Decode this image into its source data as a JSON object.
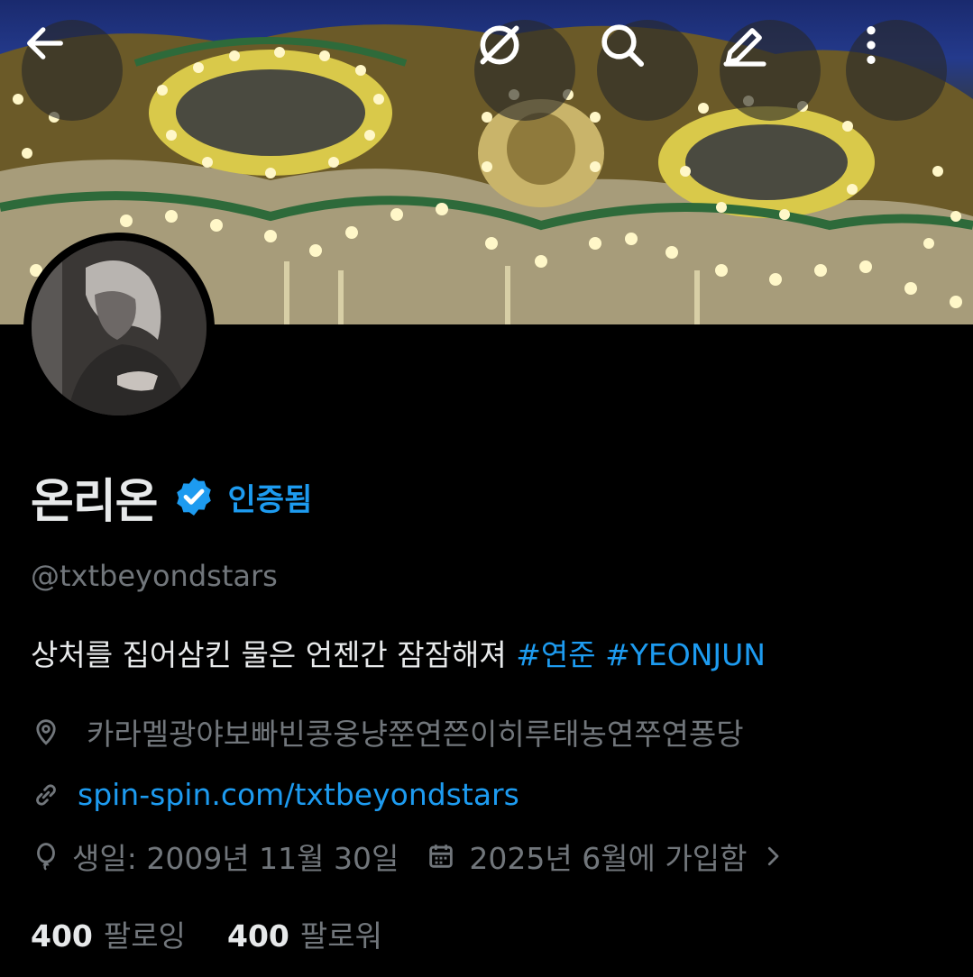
{
  "profile": {
    "display_name": "온리온",
    "verified_label": "인증됨",
    "handle": "@txtbeyondstars",
    "bio_text": "상처를 집어삼킨 물은 언젠간 잠잠해져 ",
    "hashtags": [
      "#연준",
      "#YEONJUN"
    ],
    "location": "카라멜광야보빠빈콩웅냥쭌연쯘이히루태농연쭈연퐁당",
    "website": "spin-spin.com/txtbeyondstars",
    "birthday": "생일: 2009년 11월 30일",
    "joined": "2025년 6월에 가입함",
    "following_count": "400",
    "following_label": "팔로잉",
    "followers_count": "400",
    "followers_label": "팔로워"
  },
  "icons": {
    "back": "arrow-left-icon",
    "grok": "grok-icon",
    "search": "search-icon",
    "edit": "edit-icon",
    "more": "more-vertical-icon",
    "verified": "verified-badge-icon",
    "location": "location-pin-icon",
    "link": "link-icon",
    "birthday": "balloon-icon",
    "calendar": "calendar-icon",
    "chevron": "chevron-right-icon"
  },
  "colors": {
    "accent": "#1d9bf0",
    "text_primary": "#e7e9ea",
    "text_secondary": "#71767b",
    "background": "#000000"
  }
}
